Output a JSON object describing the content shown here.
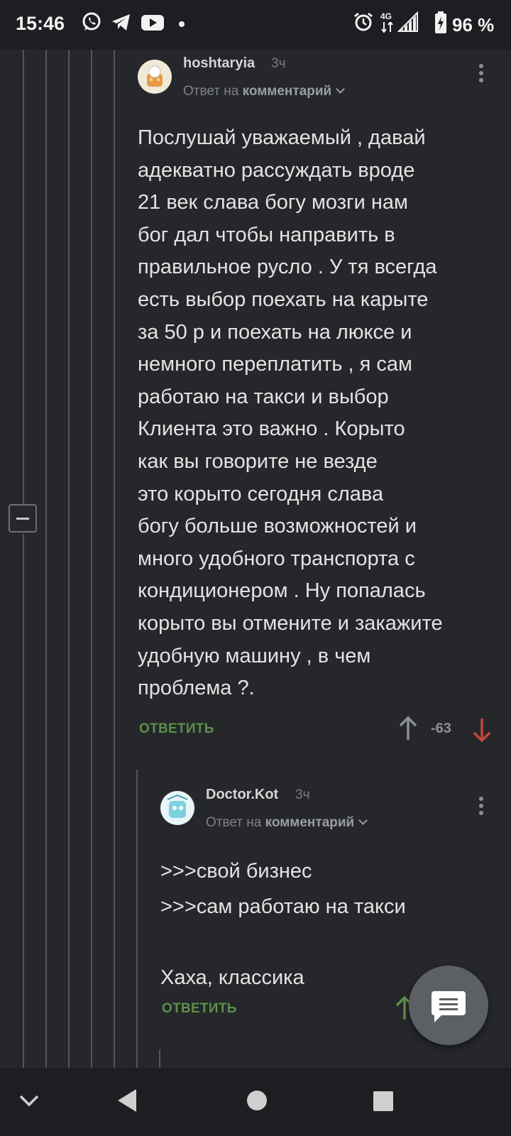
{
  "status_bar": {
    "time": "15:46",
    "notification_icons": [
      "whatsapp-icon",
      "telegram-icon",
      "youtube-icon",
      "dot-icon"
    ],
    "right_icons": [
      "alarm-icon",
      "network-4g-icon",
      "signal-icon",
      "battery-icon"
    ],
    "network_label": "4G",
    "battery": "96 %"
  },
  "comments": [
    {
      "author": "hoshtaryia",
      "time": "3ч",
      "reply_prefix": "Ответ на",
      "reply_target": "комментарий",
      "body": "Послушай уважаемый , давай\nадекватно рассуждать вроде\n21 век слава богу мозги нам\nбог дал чтобы направить в\nправильное русло . У тя всегда\nесть выбор поехать на карыте\nза 50 р и поехать на люксе и\nнемного переплатить , я сам\nработаю на такси и выбор\nКлиента это важно . Корыто\nкак вы говорите не везде\nэто корыто сегодня слава\nбогу больше возможностей и\nмного удобного транспорта с\nкондиционером . Ну попалась\nкорыто вы отмените и закажите\nудобную машину , в чем\nпроблема ?.",
      "reply_label": "ОТВЕТИТЬ",
      "rating": "-63"
    },
    {
      "author": "Doctor.Kot",
      "time": "3ч",
      "reply_prefix": "Ответ на",
      "reply_target": "комментарий",
      "body": ">>>свой бизнес\n>>>сам работаю на такси\n\nХаха, классика",
      "reply_label": "ОТВЕТИТЬ"
    }
  ],
  "colors": {
    "background": "#25272b",
    "reply_green": "#5d8f4a",
    "downvote_red": "#c0473c",
    "thread_line": "#53565c"
  },
  "fab": {
    "icon": "comment-icon"
  },
  "nav_bar": {
    "icons": [
      "chevron-down-icon",
      "back-icon",
      "home-icon",
      "recents-icon"
    ]
  }
}
